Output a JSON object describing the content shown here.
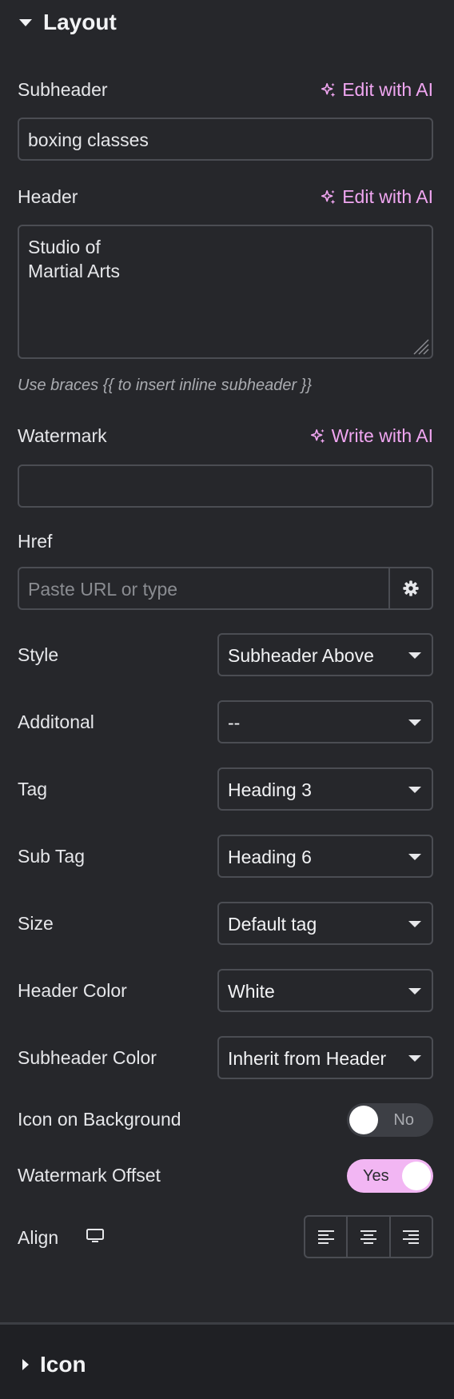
{
  "sections": {
    "layout_title": "Layout",
    "icon_title": "Icon"
  },
  "ai": {
    "edit_label": "Edit with AI",
    "write_label": "Write with AI"
  },
  "fields": {
    "subheader": {
      "label": "Subheader",
      "value": "boxing classes"
    },
    "header": {
      "label": "Header",
      "value": "Studio of\nMartial Arts"
    },
    "hint": "Use braces {{ to insert inline subheader }}",
    "watermark": {
      "label": "Watermark",
      "value": ""
    },
    "href": {
      "label": "Href",
      "placeholder": "Paste URL or type"
    }
  },
  "selects": {
    "style": {
      "label": "Style",
      "value": "Subheader Above"
    },
    "additional": {
      "label": "Additonal",
      "value": "--"
    },
    "tag": {
      "label": "Tag",
      "value": "Heading 3"
    },
    "sub_tag": {
      "label": "Sub Tag",
      "value": "Heading 6"
    },
    "size": {
      "label": "Size",
      "value": "Default tag"
    },
    "header_color": {
      "label": "Header Color",
      "value": "White"
    },
    "subheader_color": {
      "label": "Subheader Color",
      "value": "Inherit from Header"
    }
  },
  "toggles": {
    "icon_on_background": {
      "label": "Icon on Background",
      "value": "No",
      "on": false
    },
    "watermark_offset": {
      "label": "Watermark Offset",
      "value": "Yes",
      "on": true
    }
  },
  "align": {
    "label": "Align",
    "options": [
      "align-left-icon",
      "align-center-icon",
      "align-right-icon"
    ]
  },
  "colors": {
    "accent": "#f0a6f1",
    "toggle_on": "#f2b6f3",
    "panel_bg": "#26272b"
  }
}
